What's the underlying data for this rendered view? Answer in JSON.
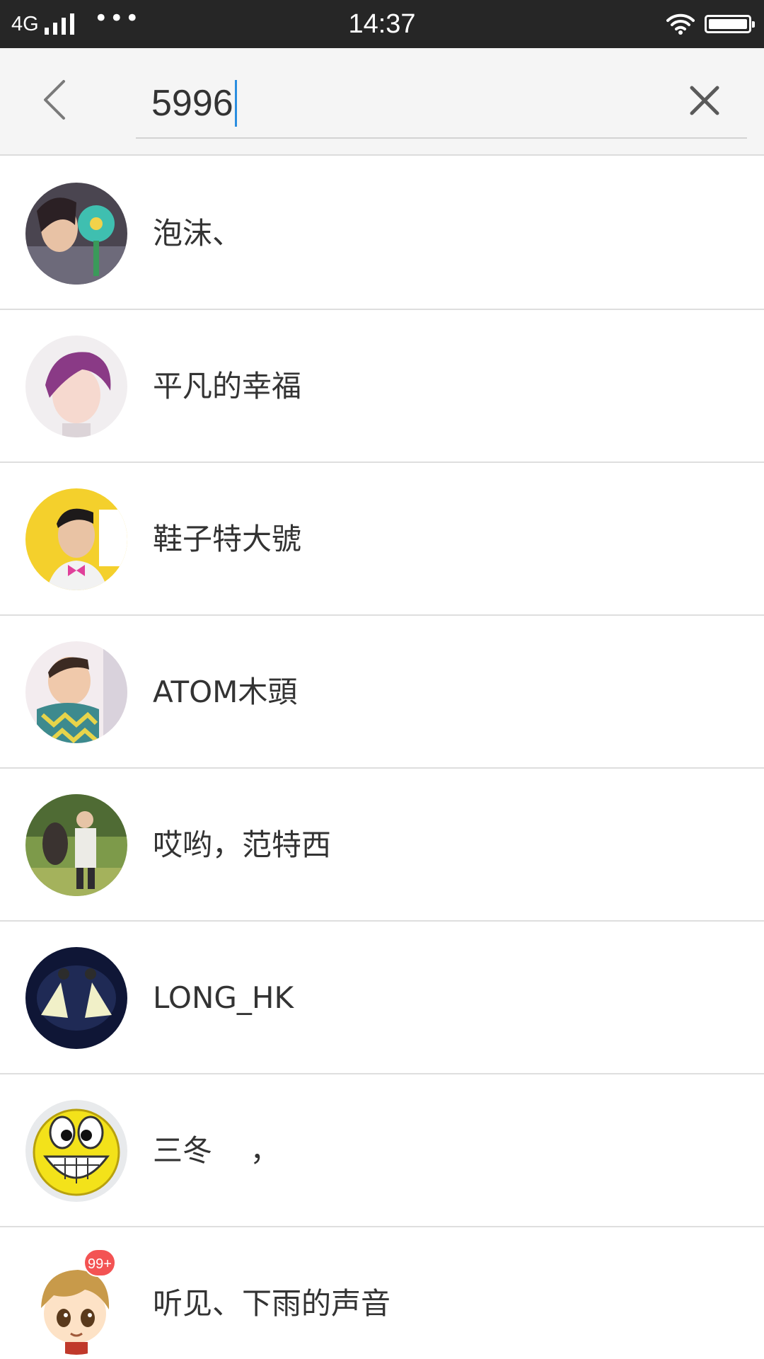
{
  "status_bar": {
    "network": "4G",
    "time": "14:37",
    "more_dots": "•••",
    "icons": [
      "signal-icon",
      "more-icon",
      "wifi-icon",
      "battery-icon"
    ]
  },
  "search": {
    "value": "5996",
    "back_icon": "chevron-left-icon",
    "clear_icon": "close-icon"
  },
  "results": [
    {
      "name": "泡沫、",
      "avatar": "photo-avatar"
    },
    {
      "name": "平凡的幸福",
      "avatar": "photo-avatar"
    },
    {
      "name": "鞋子特大號",
      "avatar": "photo-avatar"
    },
    {
      "name": "ATOM木頭",
      "avatar": "photo-avatar"
    },
    {
      "name": "哎哟，范特西",
      "avatar": "photo-avatar"
    },
    {
      "name": "LONG_HK",
      "avatar": "photo-avatar"
    },
    {
      "name": "三冬    ，",
      "avatar": "smiley-avatar"
    },
    {
      "name": "听见、下雨的声音",
      "avatar": "cartoon-avatar",
      "badge": "99+"
    }
  ],
  "colors": {
    "status_bar_bg": "#262626",
    "header_bg": "#f5f5f5",
    "caret": "#2a8ee0",
    "text": "#333333",
    "divider": "#dedede",
    "badge": "#f35353"
  }
}
